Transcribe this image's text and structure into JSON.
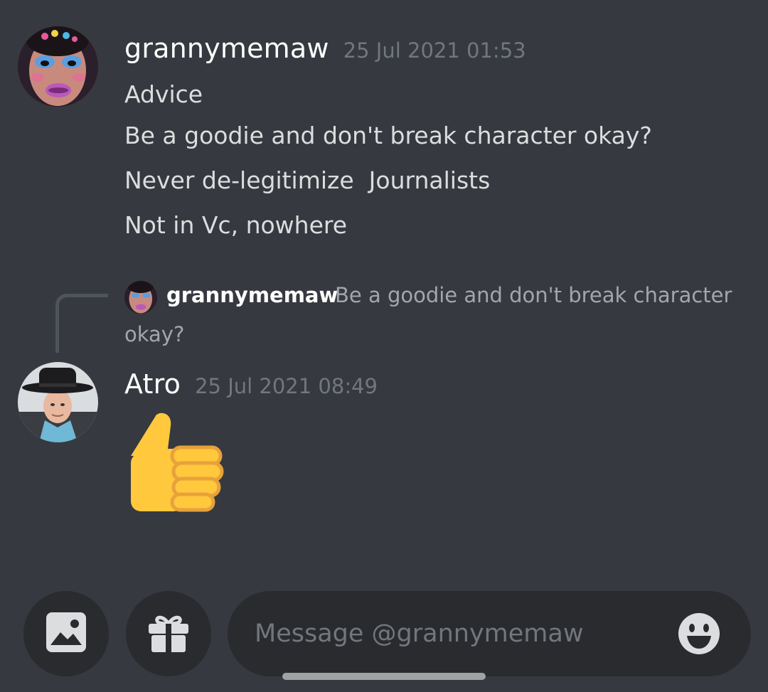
{
  "messages": [
    {
      "author": "grannymemaw",
      "timestamp": "25 Jul 2021 01:53",
      "lines": [
        "Advice",
        "Be a goodie and don't break character okay?",
        "Never de-legitimize  Journalists",
        "Not in Vc, nowhere"
      ],
      "avatar_icon": "avatar-grannymemaw"
    },
    {
      "reply_to": {
        "author": "grannymemaw",
        "text_line1": "Be a goodie and don't break character",
        "text_line2": "okay?"
      },
      "author": "Atro",
      "timestamp": "25 Jul 2021 08:49",
      "content_emoji": "thumbs-up-icon",
      "avatar_icon": "avatar-atro"
    }
  ],
  "composer": {
    "placeholder": "Message @grannymemaw",
    "image_button_icon": "image-icon",
    "gift_button_icon": "gift-icon",
    "emoji_button_icon": "emoji-icon"
  },
  "colors": {
    "background": "#36393f",
    "input_background": "#292b2f",
    "text": "#dcddde",
    "muted": "#72767d",
    "thumb": "#ffc83d"
  }
}
